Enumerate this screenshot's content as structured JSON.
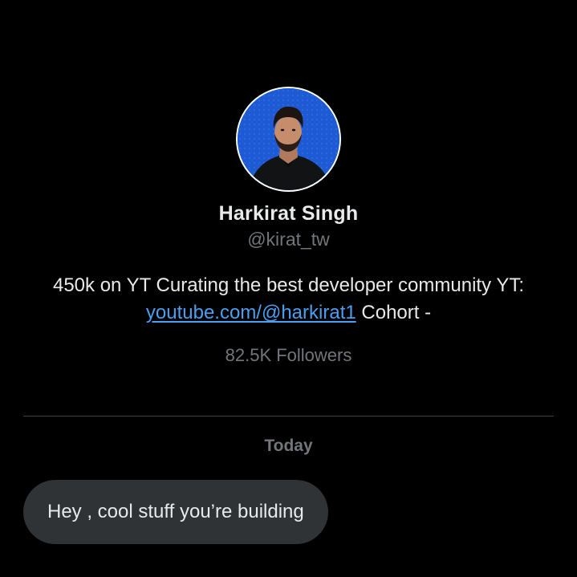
{
  "profile": {
    "name": "Harkirat Singh",
    "handle": "@kirat_tw",
    "bio_text": "450k on YT Curating the best developer community YT: ",
    "bio_link": "youtube.com/@harkirat1",
    "bio_suffix": " Cohort -",
    "followers": "82.5K Followers"
  },
  "conversation": {
    "date_separator": "Today",
    "messages": [
      {
        "text": "Hey , cool stuff you’re building",
        "direction": "received"
      }
    ]
  },
  "colors": {
    "background": "#000000",
    "primary_text": "#e7e9ea",
    "secondary_text": "#71767b",
    "link": "#4a9ff0",
    "bubble": "#2f3336",
    "avatar_bg": "#1f5fd6"
  }
}
